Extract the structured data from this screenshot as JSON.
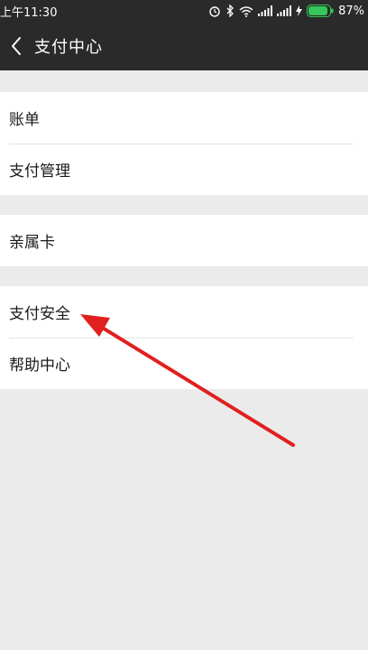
{
  "status": {
    "time": "上午11:30",
    "battery": "87%"
  },
  "header": {
    "title": "支付中心"
  },
  "groups": [
    {
      "items": [
        "账单",
        "支付管理"
      ]
    },
    {
      "items": [
        "亲属卡"
      ]
    },
    {
      "items": [
        "支付安全",
        "帮助中心"
      ]
    }
  ],
  "annotation": {
    "arrow_color": "#e0201e"
  },
  "colors": {
    "bar": "#2a2a2a",
    "background": "#ebebeb",
    "battery": "#34c759"
  }
}
